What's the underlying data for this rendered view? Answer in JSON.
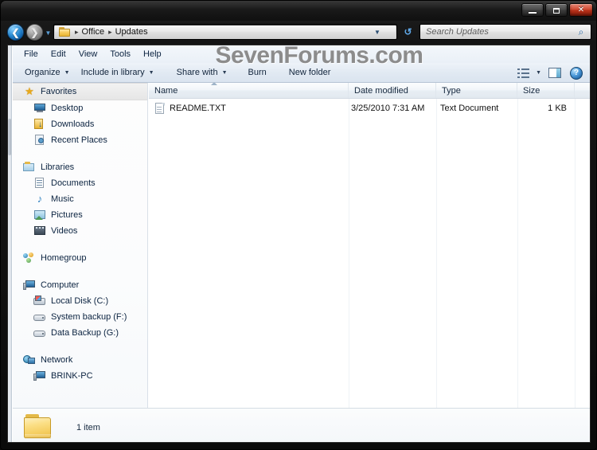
{
  "window": {
    "title": "",
    "controls": {
      "minimize": "minimize",
      "maximize": "maximize",
      "close": "✕"
    }
  },
  "address_bar": {
    "back_arrow": "❮",
    "forward_arrow": "❯",
    "history_caret": "▼",
    "folder_icon": "folder-icon",
    "separator": "▸",
    "crumbs": [
      "Office",
      "Updates"
    ],
    "dropdown_caret": "▼",
    "refresh_icon": "↺"
  },
  "search": {
    "placeholder": "Search Updates",
    "icon": "search-icon",
    "glyph": "⌕"
  },
  "menubar": {
    "items": [
      "File",
      "Edit",
      "View",
      "Tools",
      "Help"
    ]
  },
  "toolbar": {
    "items": [
      {
        "label": "Organize",
        "caret": "▼"
      },
      {
        "label": "Include in library",
        "caret": "▼"
      },
      {
        "label": "Share with",
        "caret": "▼"
      },
      {
        "label": "Burn",
        "caret": ""
      },
      {
        "label": "New folder",
        "caret": ""
      }
    ],
    "view_caret": "▼",
    "help_glyph": "?"
  },
  "watermark": {
    "text": "SevenForums.com",
    "color": "#8c8c8c"
  },
  "navpane": {
    "groups": [
      {
        "header": {
          "label": "Favorites",
          "icon": "star-icon",
          "selected": true
        },
        "children": [
          {
            "label": "Desktop",
            "icon": "monitor-icon"
          },
          {
            "label": "Downloads",
            "icon": "downloads-icon"
          },
          {
            "label": "Recent Places",
            "icon": "recent-places-icon"
          }
        ]
      },
      {
        "header": {
          "label": "Libraries",
          "icon": "library-icon",
          "selected": false
        },
        "children": [
          {
            "label": "Documents",
            "icon": "document-icon"
          },
          {
            "label": "Music",
            "icon": "music-note-icon"
          },
          {
            "label": "Pictures",
            "icon": "picture-icon"
          },
          {
            "label": "Videos",
            "icon": "video-icon"
          }
        ]
      },
      {
        "header": {
          "label": "Homegroup",
          "icon": "homegroup-icon",
          "selected": false
        },
        "children": []
      },
      {
        "header": {
          "label": "Computer",
          "icon": "computer-icon",
          "selected": false
        },
        "children": [
          {
            "label": "Local Disk (C:)",
            "icon": "local-disk-icon"
          },
          {
            "label": "System backup (F:)",
            "icon": "drive-icon"
          },
          {
            "label": "Data Backup (G:)",
            "icon": "drive-icon"
          }
        ]
      },
      {
        "header": {
          "label": "Network",
          "icon": "network-icon",
          "selected": false
        },
        "children": [
          {
            "label": "BRINK-PC",
            "icon": "network-computer-icon"
          }
        ]
      }
    ]
  },
  "filelist": {
    "columns": [
      {
        "label": "Name",
        "align": "left"
      },
      {
        "label": "Date modified",
        "align": "left"
      },
      {
        "label": "Type",
        "align": "left"
      },
      {
        "label": "Size",
        "align": "right"
      }
    ],
    "sort_column": "Name",
    "sort_direction": "ascending",
    "rows": [
      {
        "name": "README.TXT",
        "icon": "text-document-icon",
        "date_modified": "3/25/2010 7:31 AM",
        "type": "Text Document",
        "size": "1 KB"
      }
    ]
  },
  "statusbar": {
    "folder_icon": "folder-icon",
    "item_count_text": "1 item"
  }
}
